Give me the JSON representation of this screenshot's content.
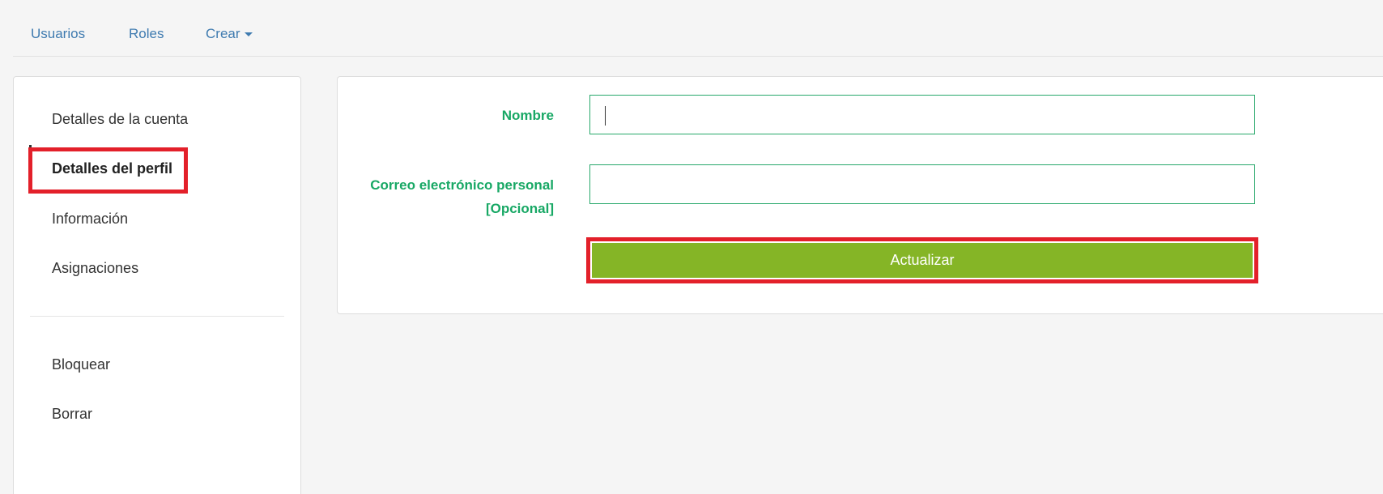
{
  "topnav": {
    "users": "Usuarios",
    "roles": "Roles",
    "create": "Crear"
  },
  "sidebar": {
    "items": [
      {
        "label": "Detalles de la cuenta"
      },
      {
        "label": "Detalles del perfil"
      },
      {
        "label": "Información"
      },
      {
        "label": "Asignaciones"
      },
      {
        "label": "Bloquear"
      },
      {
        "label": "Borrar"
      }
    ],
    "active": "Detalles del perfil"
  },
  "form": {
    "name_label": "Nombre",
    "name_value": "",
    "email_label_line1": "Correo electrónico personal",
    "email_label_line2": "[Opcional]",
    "email_value": "",
    "update_button": "Actualizar"
  },
  "colors": {
    "link": "#3f7bb0",
    "label_green": "#18a865",
    "button_green": "#85b526",
    "highlight_red": "#e3202a"
  }
}
